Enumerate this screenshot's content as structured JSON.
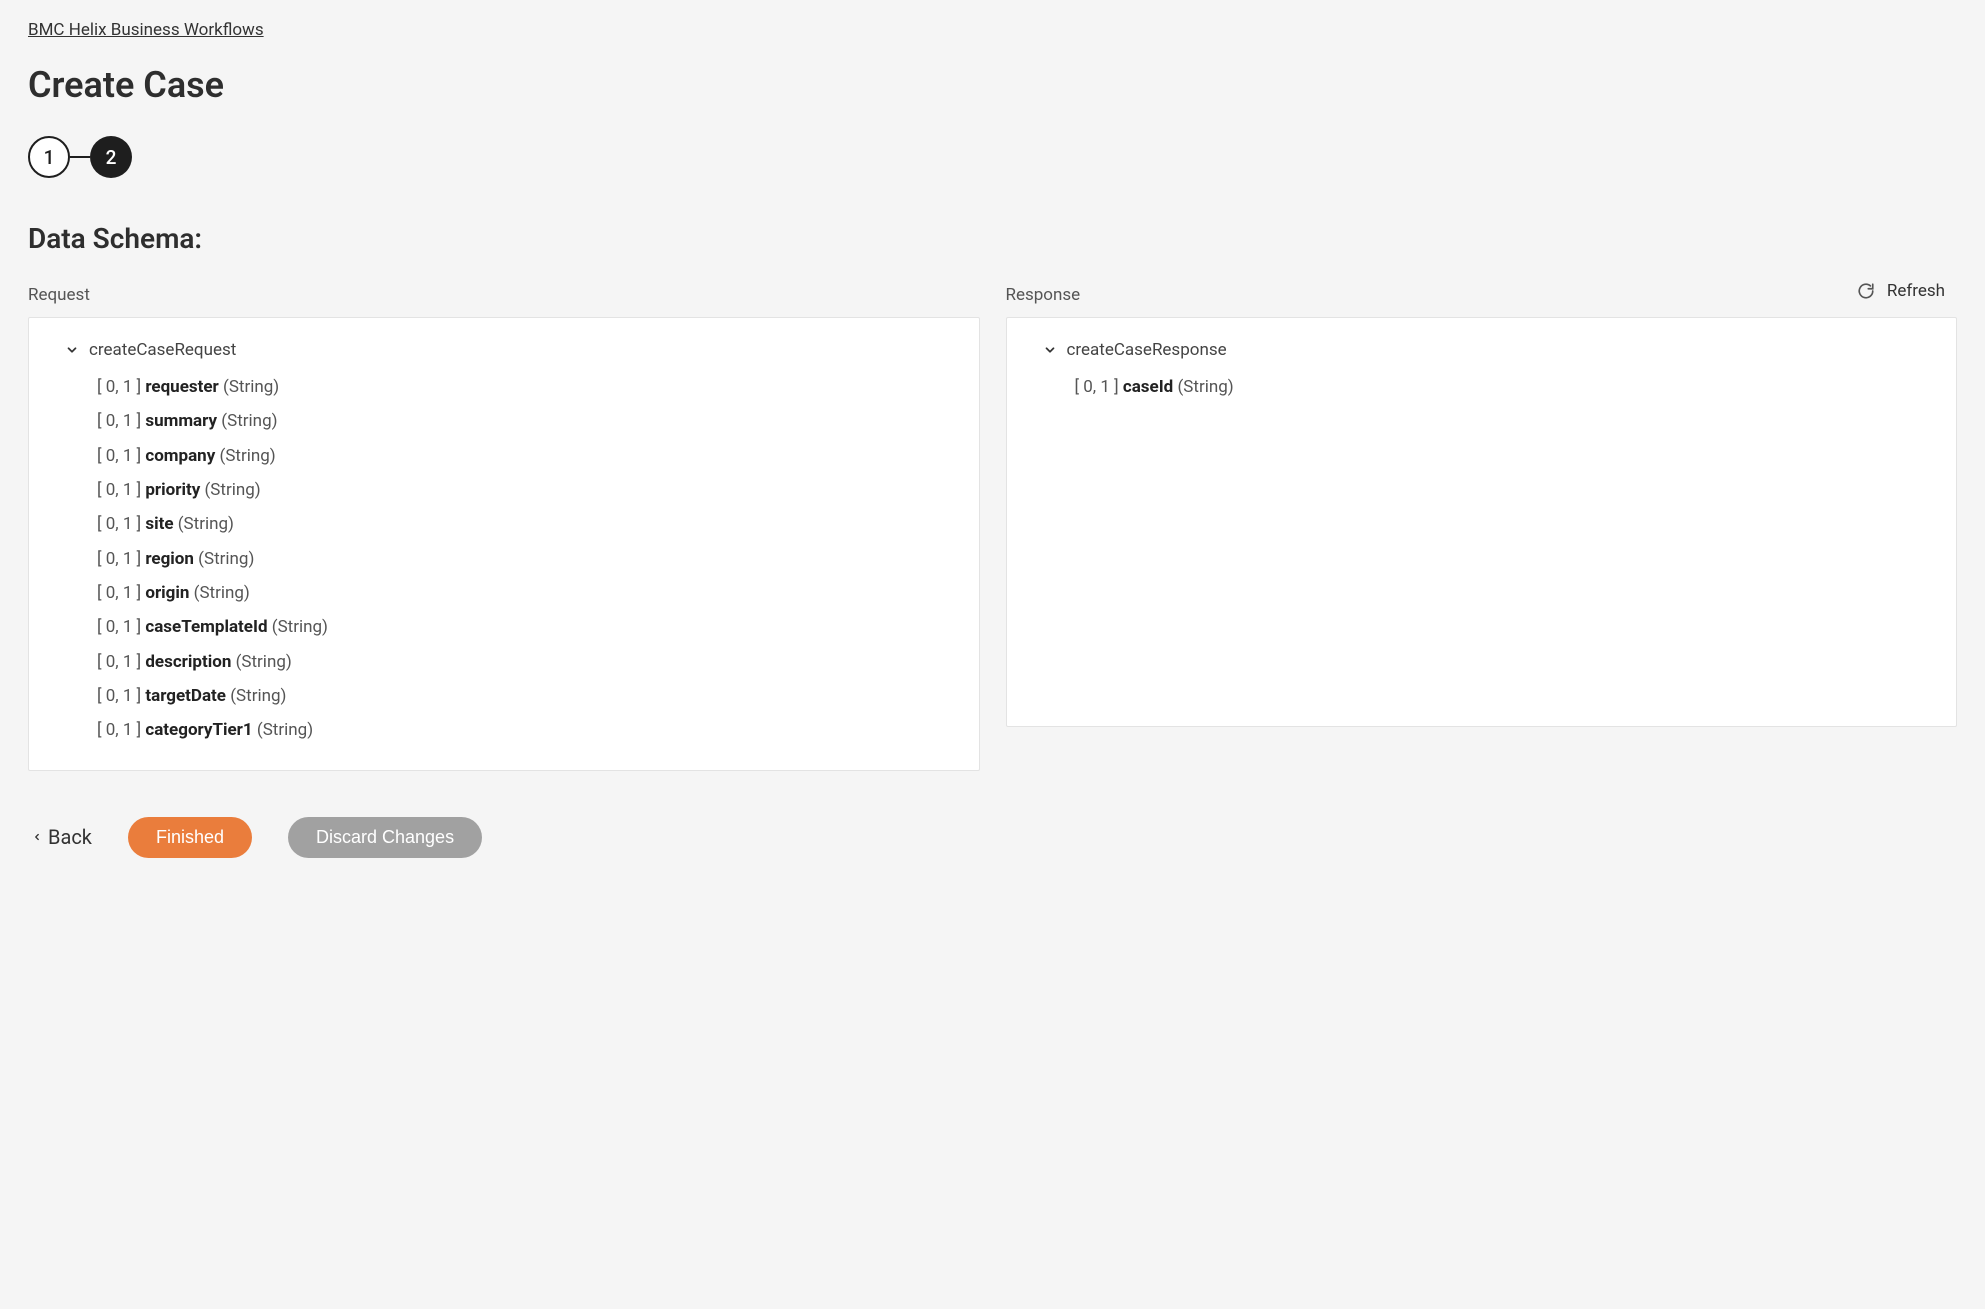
{
  "breadcrumb": "BMC Helix Business Workflows",
  "pageTitle": "Create Case",
  "stepper": {
    "step1": "1",
    "step2": "2"
  },
  "sectionHeading": "Data Schema:",
  "refreshLabel": "Refresh",
  "requestLabel": "Request",
  "responseLabel": "Response",
  "requestRoot": "createCaseRequest",
  "responseRoot": "createCaseResponse",
  "requestFields": [
    {
      "card": "[ 0, 1 ]",
      "name": "requester",
      "type": "(String)"
    },
    {
      "card": "[ 0, 1 ]",
      "name": "summary",
      "type": "(String)"
    },
    {
      "card": "[ 0, 1 ]",
      "name": "company",
      "type": "(String)"
    },
    {
      "card": "[ 0, 1 ]",
      "name": "priority",
      "type": "(String)"
    },
    {
      "card": "[ 0, 1 ]",
      "name": "site",
      "type": "(String)"
    },
    {
      "card": "[ 0, 1 ]",
      "name": "region",
      "type": "(String)"
    },
    {
      "card": "[ 0, 1 ]",
      "name": "origin",
      "type": "(String)"
    },
    {
      "card": "[ 0, 1 ]",
      "name": "caseTemplateId",
      "type": "(String)"
    },
    {
      "card": "[ 0, 1 ]",
      "name": "description",
      "type": "(String)"
    },
    {
      "card": "[ 0, 1 ]",
      "name": "targetDate",
      "type": "(String)"
    },
    {
      "card": "[ 0, 1 ]",
      "name": "categoryTier1",
      "type": "(String)"
    }
  ],
  "responseFields": [
    {
      "card": "[ 0, 1 ]",
      "name": "caseId",
      "type": "(String)"
    }
  ],
  "footer": {
    "back": "Back",
    "finished": "Finished",
    "discard": "Discard Changes"
  }
}
